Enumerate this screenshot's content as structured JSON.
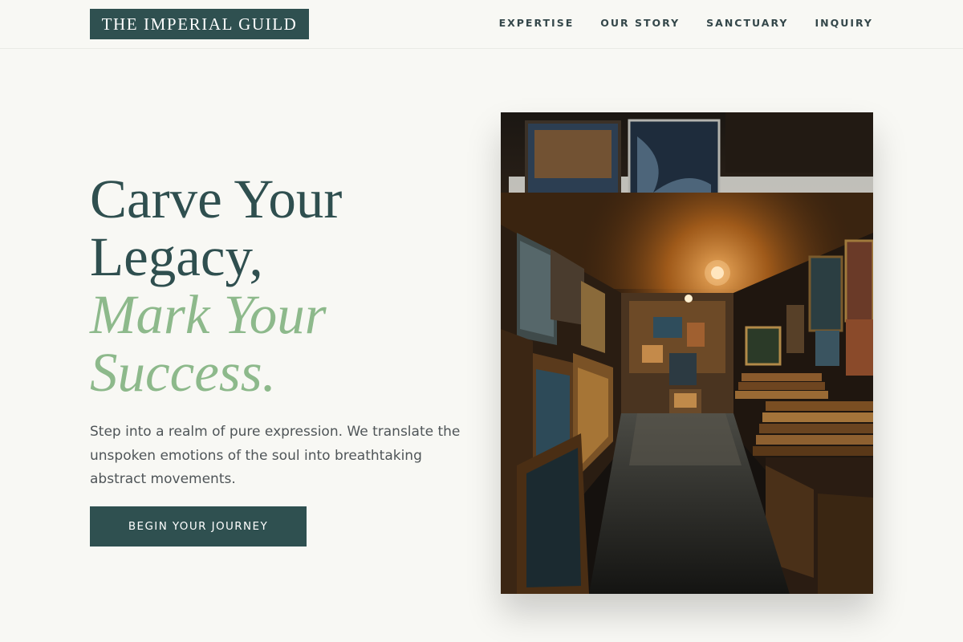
{
  "brand": {
    "logo_text": "THE IMPERIAL GUILD"
  },
  "nav": {
    "items": [
      {
        "label": "EXPERTISE"
      },
      {
        "label": "OUR STORY"
      },
      {
        "label": "SANCTUARY"
      },
      {
        "label": "INQUIRY"
      }
    ]
  },
  "hero": {
    "headline_line1": "Carve Your",
    "headline_line2": "Legacy,",
    "headline_line3": "Mark Your",
    "headline_line4": "Success.",
    "intro": "Step into a realm of pure expression. We translate the unspoken emotions of the soul into breathtaking abstract movements.",
    "cta_label": "BEGIN YOUR JOURNEY",
    "image_subject": "art-gallery-corridor-photo"
  },
  "colors": {
    "brand_dark": "#2f5050",
    "accent_green": "#8db98b",
    "background": "#f8f8f4",
    "body_text": "#4f5558"
  }
}
